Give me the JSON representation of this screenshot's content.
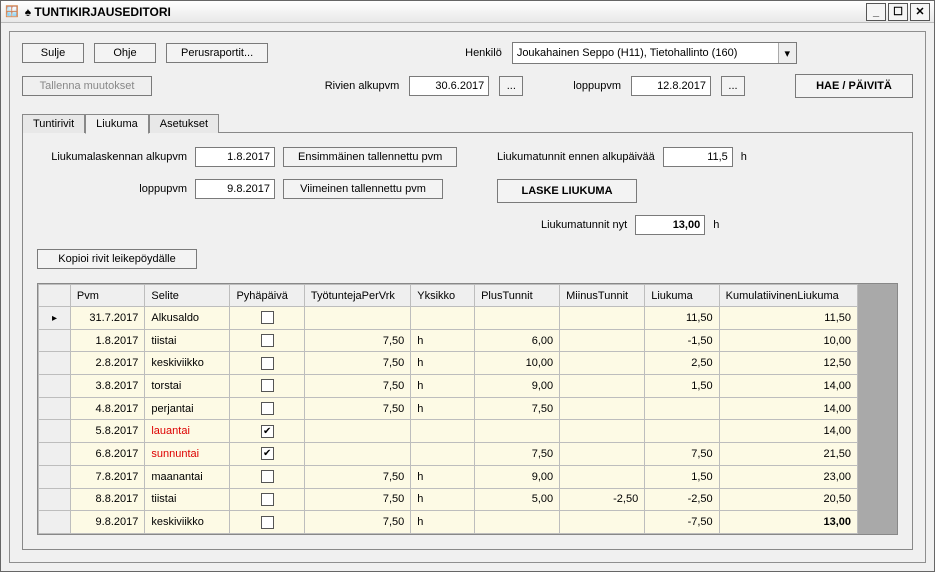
{
  "window": {
    "title": "♠ TUNTIKIRJAUSEDITORI"
  },
  "buttons": {
    "sulje": "Sulje",
    "ohje": "Ohje",
    "perusraportit": "Perusraportit...",
    "tallenna": "Tallenna muutokset",
    "hae": "HAE / PÄIVITÄ",
    "kopioi": "Kopioi rivit leikepöydälle",
    "ensimmainen": "Ensimmäinen tallennettu pvm",
    "viimeinen": "Viimeinen tallennettu pvm",
    "laske": "LASKE LIUKUMA"
  },
  "labels": {
    "henkilo": "Henkilö",
    "rivien_alkupvm": "Rivien alkupvm",
    "loppupvm": "loppupvm",
    "liukuma_alkupvm": "Liukumalaskennan alkupvm",
    "liukuma_loppupvm": "loppupvm",
    "liukuma_ennen": "Liukumatunnit ennen alkupäivää",
    "liukuma_nyt": "Liukumatunnit nyt",
    "h_unit": "h"
  },
  "fields": {
    "henkilo_value": "Joukahainen Seppo (H11), Tietohallinto (160)",
    "alkupvm": "30.6.2017",
    "loppupvm": "12.8.2017",
    "liukuma_alkupvm": "1.8.2017",
    "liukuma_loppupvm": "9.8.2017",
    "liukuma_ennen": "11,5",
    "liukuma_nyt": "13,00"
  },
  "tabs": {
    "t1": "Tuntirivit",
    "t2": "Liukuma",
    "t3": "Asetukset"
  },
  "grid": {
    "headers": {
      "pvm": "Pvm",
      "selite": "Selite",
      "pyha": "Pyhäpäivä",
      "tyotunteja": "TyötuntejaPerVrk",
      "yksikko": "Yksikko",
      "plus": "PlusTunnit",
      "miinus": "MiinusTunnit",
      "liukuma": "Liukuma",
      "kumul": "KumulatiivinenLiukuma"
    },
    "rows": [
      {
        "pvm": "31.7.2017",
        "selite": "Alkusaldo",
        "pyha": false,
        "tyo": "",
        "yks": "",
        "plus": "",
        "miinus": "",
        "liuk": "11,50",
        "kum": "11,50",
        "weekend": false,
        "current": true
      },
      {
        "pvm": "1.8.2017",
        "selite": "tiistai",
        "pyha": false,
        "tyo": "7,50",
        "yks": "h",
        "plus": "6,00",
        "miinus": "",
        "liuk": "-1,50",
        "kum": "10,00",
        "weekend": false
      },
      {
        "pvm": "2.8.2017",
        "selite": "keskiviikko",
        "pyha": false,
        "tyo": "7,50",
        "yks": "h",
        "plus": "10,00",
        "miinus": "",
        "liuk": "2,50",
        "kum": "12,50",
        "weekend": false
      },
      {
        "pvm": "3.8.2017",
        "selite": "torstai",
        "pyha": false,
        "tyo": "7,50",
        "yks": "h",
        "plus": "9,00",
        "miinus": "",
        "liuk": "1,50",
        "kum": "14,00",
        "weekend": false
      },
      {
        "pvm": "4.8.2017",
        "selite": "perjantai",
        "pyha": false,
        "tyo": "7,50",
        "yks": "h",
        "plus": "7,50",
        "miinus": "",
        "liuk": "",
        "kum": "14,00",
        "weekend": false
      },
      {
        "pvm": "5.8.2017",
        "selite": "lauantai",
        "pyha": true,
        "tyo": "",
        "yks": "",
        "plus": "",
        "miinus": "",
        "liuk": "",
        "kum": "14,00",
        "weekend": true
      },
      {
        "pvm": "6.8.2017",
        "selite": "sunnuntai",
        "pyha": true,
        "tyo": "",
        "yks": "",
        "plus": "7,50",
        "miinus": "",
        "liuk": "7,50",
        "kum": "21,50",
        "weekend": true
      },
      {
        "pvm": "7.8.2017",
        "selite": "maanantai",
        "pyha": false,
        "tyo": "7,50",
        "yks": "h",
        "plus": "9,00",
        "miinus": "",
        "liuk": "1,50",
        "kum": "23,00",
        "weekend": false
      },
      {
        "pvm": "8.8.2017",
        "selite": "tiistai",
        "pyha": false,
        "tyo": "7,50",
        "yks": "h",
        "plus": "5,00",
        "miinus": "-2,50",
        "liuk": "-2,50",
        "kum": "20,50",
        "weekend": false
      },
      {
        "pvm": "9.8.2017",
        "selite": "keskiviikko",
        "pyha": false,
        "tyo": "7,50",
        "yks": "h",
        "plus": "",
        "miinus": "",
        "liuk": "-7,50",
        "kum": "13,00",
        "weekend": false,
        "bold": true
      }
    ]
  }
}
